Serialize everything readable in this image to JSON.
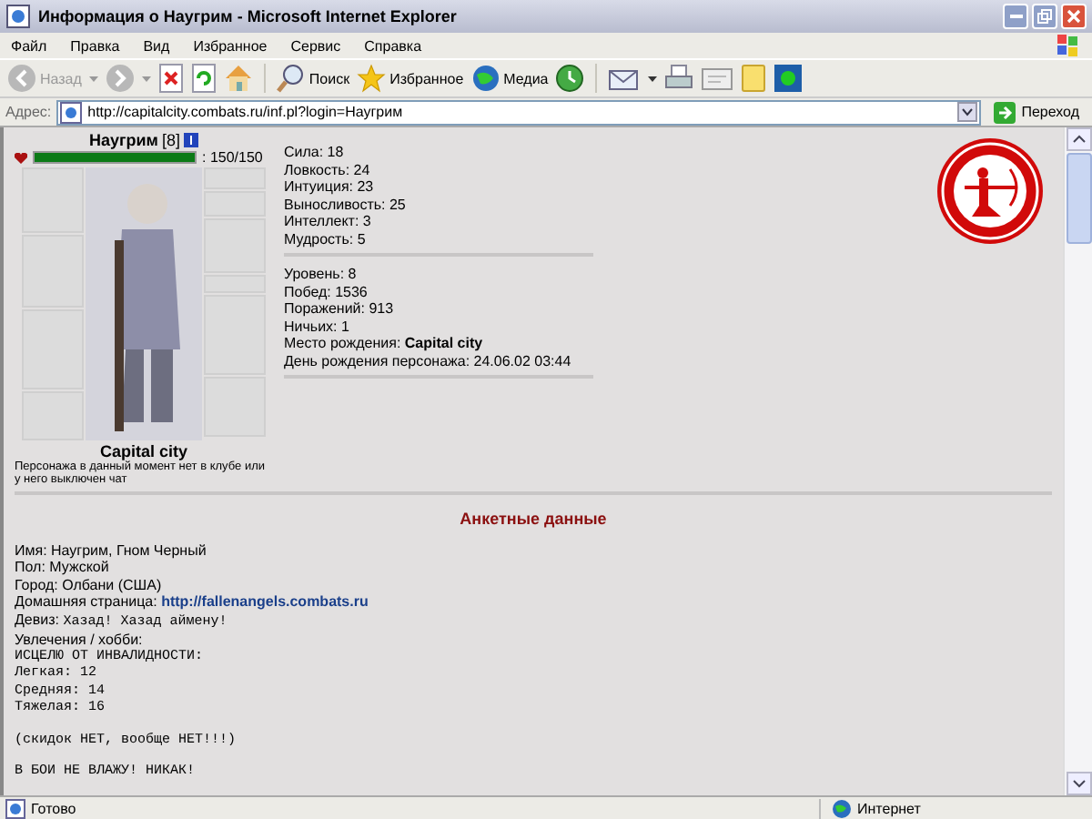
{
  "window": {
    "title": "Информация о Наугрим - Microsoft Internet Explorer"
  },
  "menu": [
    "Файл",
    "Правка",
    "Вид",
    "Избранное",
    "Сервис",
    "Справка"
  ],
  "toolbar": {
    "back": "Назад",
    "search": "Поиск",
    "favorites": "Избранное",
    "media": "Медиа"
  },
  "address": {
    "label": "Адрес:",
    "value": "http://capitalcity.combats.ru/inf.pl?login=Наугрим",
    "go": "Переход"
  },
  "character": {
    "name": "Наугрим",
    "level": "[8]",
    "health": {
      "level": 1.0,
      "reading": ": 150/150"
    },
    "city": "Capital city",
    "chat_note": "Персонажа в данный момент нет в клубе или у него выключен чат"
  },
  "stats": [
    {
      "label": "Сила:",
      "value": "18"
    },
    {
      "label": "Ловкость:",
      "value": "24"
    },
    {
      "label": "Интуиция:",
      "value": "23"
    },
    {
      "label": "Выносливость:",
      "value": "25"
    },
    {
      "label": "Интеллект:",
      "value": "3"
    },
    {
      "label": "Мудрость:",
      "value": "5"
    }
  ],
  "records": [
    {
      "label": "Уровень:",
      "value": "8",
      "kind": "plain"
    },
    {
      "label": "Побед:",
      "value": "1536",
      "kind": "plain"
    },
    {
      "label": "Поражений:",
      "value": "913",
      "kind": "plain"
    },
    {
      "label": "Ничьих:",
      "value": "1",
      "kind": "plain"
    },
    {
      "label": "Место рождения:",
      "value": "Capital city",
      "kind": "bold"
    },
    {
      "label": "День рождения персонажа:",
      "value": "24.06.02 03:44",
      "kind": "plain"
    }
  ],
  "profile": {
    "title": "Анкетные данные",
    "fields": [
      {
        "label": "Имя:",
        "value": "Наугрим, Гном Черный",
        "kind": "plain"
      },
      {
        "label": "Пол:",
        "value": "Мужской",
        "kind": "plain"
      },
      {
        "label": "Город:",
        "value": "Олбани (США)",
        "kind": "plain"
      },
      {
        "label": "Домашняя страница:",
        "value": "http://fallenangels.combats.ru",
        "kind": "link"
      },
      {
        "label": "Девиз:",
        "value": "Хазад! Хазад аймену!",
        "kind": "mono"
      },
      {
        "label": "Увлечения / хобби:",
        "kind": "plain"
      }
    ],
    "hobby_paragraphs": [
      [
        "ИСЦЕЛЮ ОТ ИНВАЛИДНОСТИ:",
        "Легкая: 12",
        "Средняя: 14",
        "Тяжелая: 16"
      ],
      [
        "(скидок НЕТ, вообще НЕТ!!!)"
      ],
      [
        "В БОИ НЕ ВЛАЖУ! НИКАК!"
      ]
    ]
  },
  "status_bar": {
    "text": "Готово",
    "zone": "Интернет"
  }
}
